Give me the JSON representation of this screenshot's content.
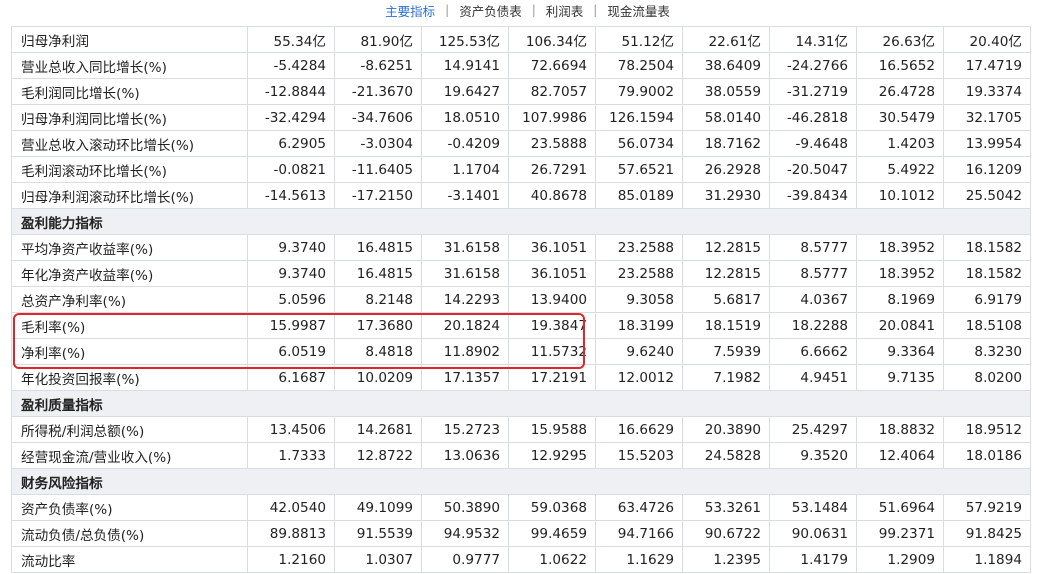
{
  "tabs": [
    "主要指标",
    "资产负债表",
    "利润表",
    "现金流量表"
  ],
  "active_tab": 0,
  "colors": {
    "accent": "#2f6fd6",
    "highlight": "#e1262b",
    "section_bg": "#eef0f3"
  },
  "rows": [
    {
      "type": "data",
      "label": "归母净利润",
      "values": [
        "55.34亿",
        "81.90亿",
        "125.53亿",
        "106.34亿",
        "51.12亿",
        "22.61亿",
        "14.31亿",
        "26.63亿",
        "20.40亿"
      ]
    },
    {
      "type": "data",
      "label": "营业总收入同比增长(%)",
      "values": [
        "-5.4284",
        "-8.6251",
        "14.9141",
        "72.6694",
        "78.2504",
        "38.6409",
        "-24.2766",
        "16.5652",
        "17.4719"
      ]
    },
    {
      "type": "data",
      "label": "毛利润同比增长(%)",
      "values": [
        "-12.8844",
        "-21.3670",
        "19.6427",
        "82.7057",
        "79.9002",
        "38.0559",
        "-31.2719",
        "26.4728",
        "19.3374"
      ]
    },
    {
      "type": "data",
      "label": "归母净利润同比增长(%)",
      "values": [
        "-32.4294",
        "-34.7606",
        "18.0510",
        "107.9986",
        "126.1594",
        "58.0140",
        "-46.2818",
        "30.5479",
        "32.1705"
      ]
    },
    {
      "type": "data",
      "label": "营业总收入滚动环比增长(%)",
      "values": [
        "6.2905",
        "-3.0304",
        "-0.4209",
        "23.5888",
        "56.0734",
        "18.7162",
        "-9.4648",
        "1.4203",
        "13.9954"
      ]
    },
    {
      "type": "data",
      "label": "毛利润滚动环比增长(%)",
      "values": [
        "-0.0821",
        "-11.6405",
        "1.1704",
        "26.7291",
        "57.6521",
        "26.2928",
        "-20.5047",
        "5.4922",
        "16.1209"
      ]
    },
    {
      "type": "data",
      "label": "归母净利润滚动环比增长(%)",
      "values": [
        "-14.5613",
        "-17.2150",
        "-3.1401",
        "40.8678",
        "85.0189",
        "31.2930",
        "-39.8434",
        "10.1012",
        "25.5042"
      ]
    },
    {
      "type": "section",
      "label": "盈利能力指标"
    },
    {
      "type": "data",
      "label": "平均净资产收益率(%)",
      "values": [
        "9.3740",
        "16.4815",
        "31.6158",
        "36.1051",
        "23.2588",
        "12.2815",
        "8.5777",
        "18.3952",
        "18.1582"
      ]
    },
    {
      "type": "data",
      "label": "年化净资产收益率(%)",
      "values": [
        "9.3740",
        "16.4815",
        "31.6158",
        "36.1051",
        "23.2588",
        "12.2815",
        "8.5777",
        "18.3952",
        "18.1582"
      ]
    },
    {
      "type": "data",
      "label": "总资产净利率(%)",
      "values": [
        "5.0596",
        "8.2148",
        "14.2293",
        "13.9400",
        "9.3058",
        "5.6817",
        "4.0367",
        "8.1969",
        "6.9179"
      ]
    },
    {
      "type": "data",
      "label": "毛利率(%)",
      "values": [
        "15.9987",
        "17.3680",
        "20.1824",
        "19.3847",
        "18.3199",
        "18.1519",
        "18.2288",
        "20.0841",
        "18.5108"
      ]
    },
    {
      "type": "data",
      "label": "净利率(%)",
      "values": [
        "6.0519",
        "8.4818",
        "11.8902",
        "11.5732",
        "9.6240",
        "7.5939",
        "6.6662",
        "9.3364",
        "8.3230"
      ]
    },
    {
      "type": "data",
      "label": "年化投资回报率(%)",
      "values": [
        "6.1687",
        "10.0209",
        "17.1357",
        "17.2191",
        "12.0012",
        "7.1982",
        "4.9451",
        "9.7135",
        "8.0200"
      ]
    },
    {
      "type": "section",
      "label": "盈利质量指标"
    },
    {
      "type": "data",
      "label": "所得税/利润总额(%)",
      "values": [
        "13.4506",
        "14.2681",
        "15.2723",
        "15.9588",
        "16.6629",
        "20.3890",
        "25.4297",
        "18.8832",
        "18.9512"
      ]
    },
    {
      "type": "data",
      "label": "经营现金流/营业收入(%)",
      "values": [
        "1.7333",
        "12.8722",
        "13.0636",
        "12.9295",
        "15.5203",
        "24.5828",
        "9.3520",
        "12.4064",
        "18.0186"
      ]
    },
    {
      "type": "section",
      "label": "财务风险指标"
    },
    {
      "type": "data",
      "label": "资产负债率(%)",
      "values": [
        "42.0540",
        "49.1099",
        "50.3890",
        "59.0368",
        "63.4726",
        "53.3261",
        "53.1484",
        "51.6964",
        "57.9219"
      ]
    },
    {
      "type": "data",
      "label": "流动负债/总负债(%)",
      "values": [
        "89.8813",
        "91.5539",
        "94.9532",
        "99.4659",
        "94.7166",
        "90.6722",
        "90.0631",
        "99.2371",
        "91.8425"
      ]
    },
    {
      "type": "data",
      "label": "流动比率",
      "values": [
        "1.2160",
        "1.0307",
        "0.9777",
        "1.0622",
        "1.1629",
        "1.2395",
        "1.4179",
        "1.2909",
        "1.1894"
      ]
    }
  ]
}
